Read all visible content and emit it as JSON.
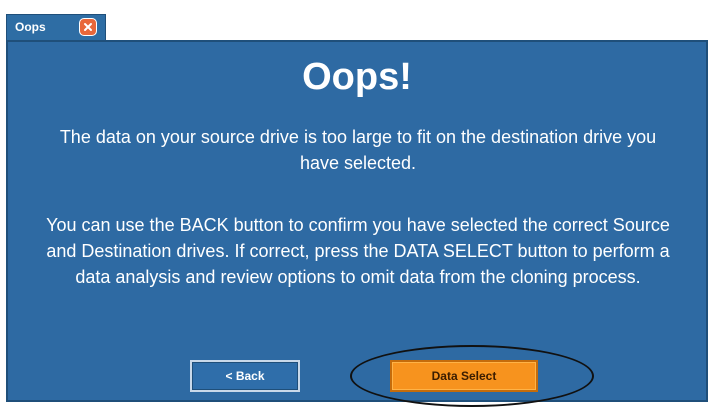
{
  "window": {
    "tab_title": "Oops",
    "close_icon": "close-icon"
  },
  "dialog": {
    "title": "Oops!",
    "message_1": "The data on your source drive is too large to fit on the destination drive you have selected.",
    "message_2": "You can use the BACK button to confirm you have selected the correct Source and Destination drives.  If correct, press the DATA SELECT button to perform a data analysis and review options to omit data from the cloning process."
  },
  "buttons": {
    "back_label": "< Back",
    "data_select_label": "Data Select"
  },
  "colors": {
    "panel_background": "#2e6aa3",
    "data_select_button": "#f7931e",
    "close_icon": "#e8673a"
  }
}
